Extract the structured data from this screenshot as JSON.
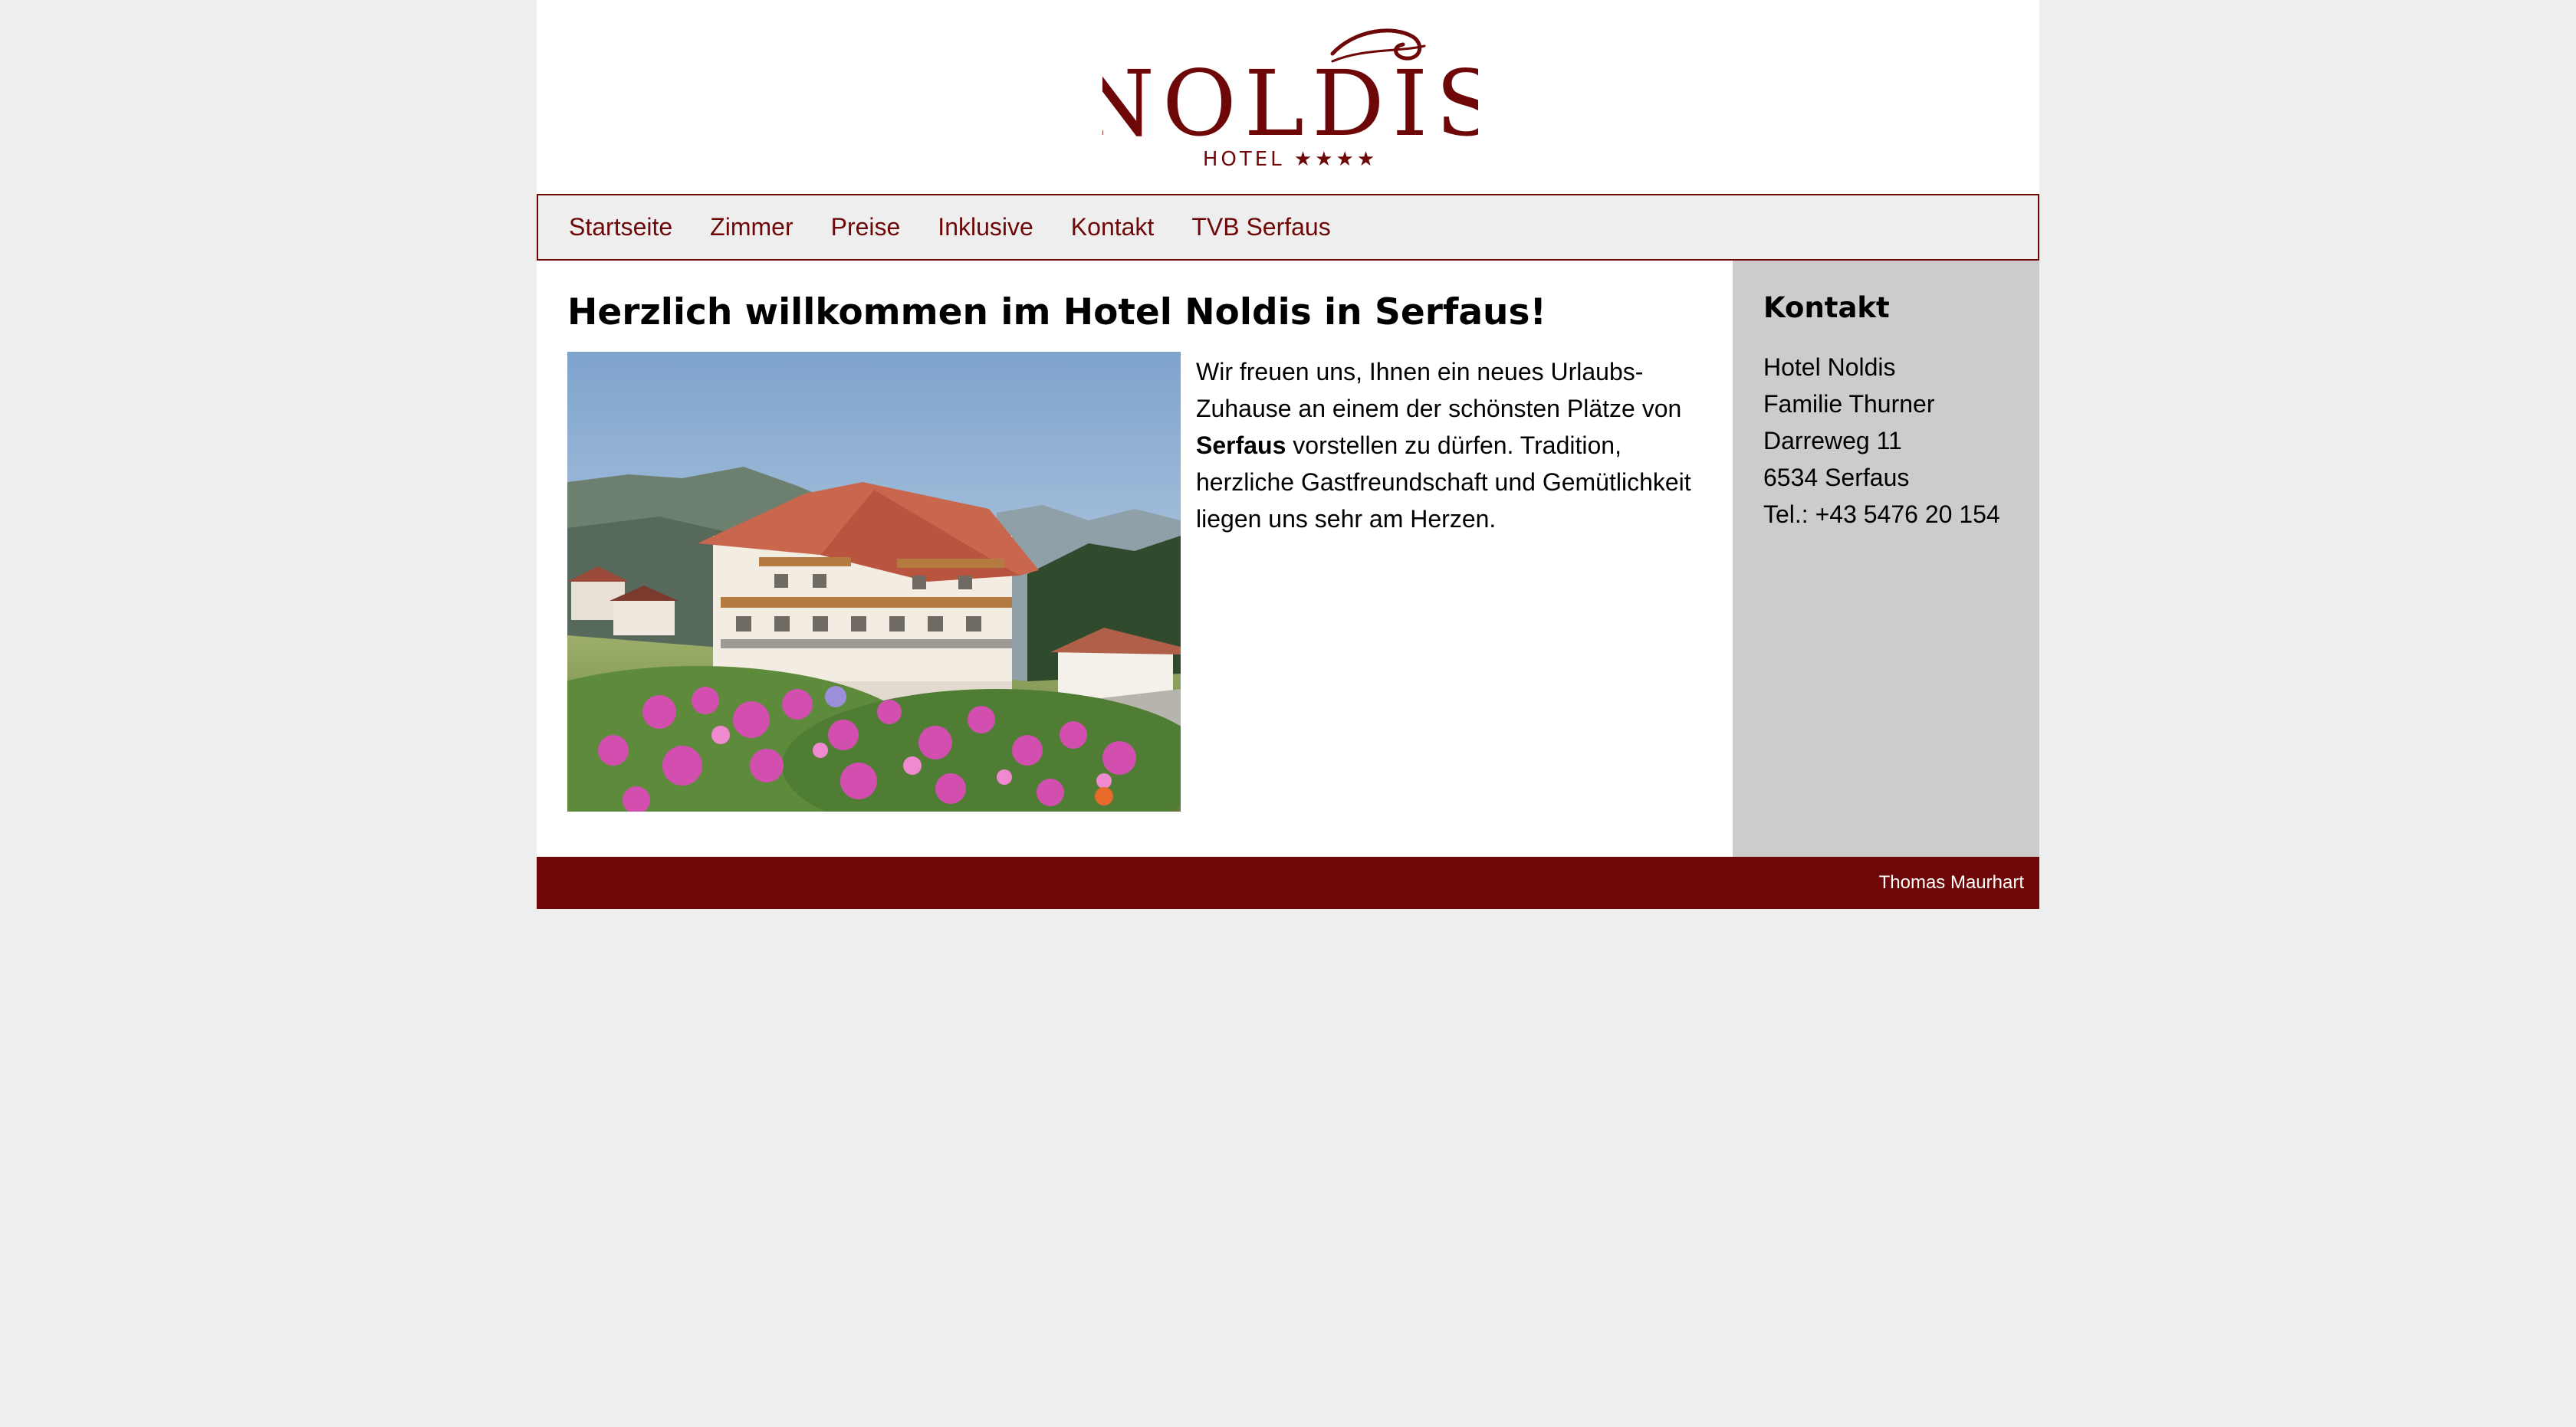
{
  "header": {
    "logo_name": "NOLDIS",
    "logo_sub": "HOTEL ★★★★"
  },
  "nav": {
    "items": [
      {
        "label": "Startseite"
      },
      {
        "label": "Zimmer"
      },
      {
        "label": "Preise"
      },
      {
        "label": "Inklusive"
      },
      {
        "label": "Kontakt"
      },
      {
        "label": "TVB Serfaus"
      }
    ]
  },
  "main": {
    "title": "Herzlich willkommen im Hotel Noldis in Serfaus!",
    "intro_part1": "Wir freuen uns, Ihnen ein neues Urlaubs-Zuhause an einem der schönsten Plätze von ",
    "intro_bold": "Serfaus",
    "intro_part2": " vorstellen zu dürfen. Tradition, herzliche Gastfreundschaft und Gemütlichkeit liegen uns sehr am Herzen."
  },
  "sidebar": {
    "title": "Kontakt",
    "lines": [
      "Hotel Noldis",
      "Familie Thurner",
      "Darreweg 11",
      "6534 Serfaus",
      "Tel.: +43 5476 20 154"
    ]
  },
  "footer": {
    "credit": "Thomas Maurhart"
  },
  "colors": {
    "brand": "#6e0808",
    "background": "#eeeeee",
    "sidebar": "#cccccc"
  }
}
